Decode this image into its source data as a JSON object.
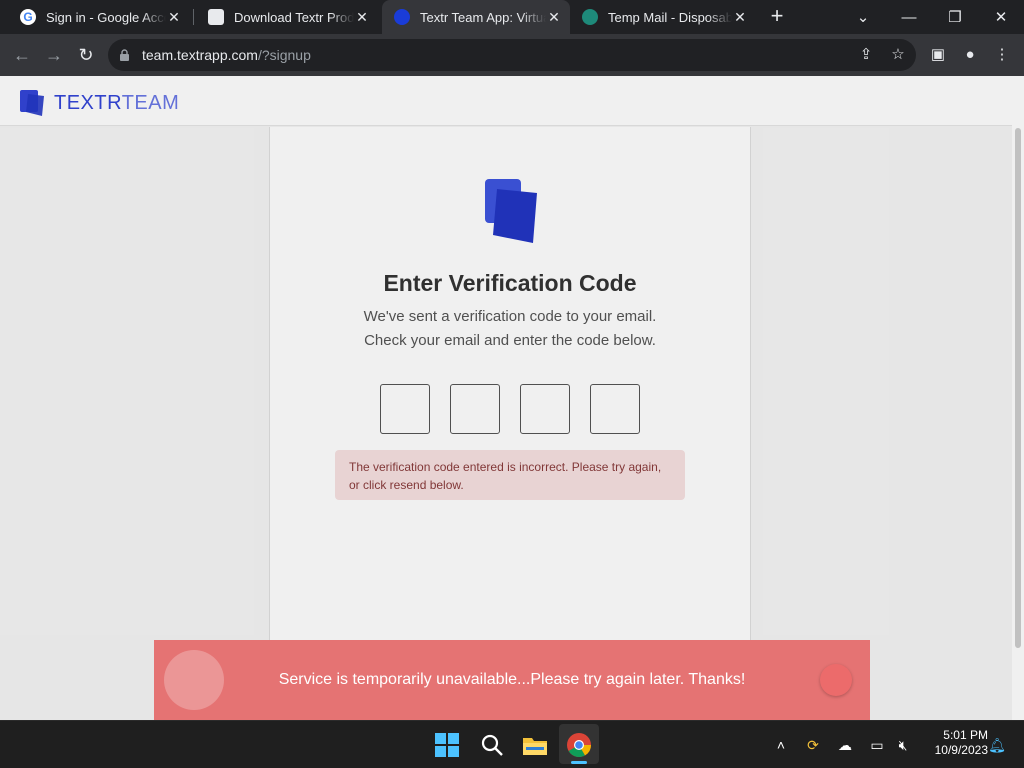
{
  "browser": {
    "tabs": [
      {
        "title": "Sign in - Google Accounts",
        "close": "✕"
      },
      {
        "title": "Download Textr Products",
        "close": "✕"
      },
      {
        "title": "Textr Team App: Virtual",
        "close": "✕"
      },
      {
        "title": "Temp Mail - Disposable",
        "close": "✕"
      }
    ],
    "new_tab": "+",
    "url_host": "team.textrapp.com",
    "url_path": "/?signup",
    "window_controls": {
      "chevron": "⌄",
      "minimize": "—",
      "restore": "❐",
      "close": "✕"
    },
    "nav": {
      "back": "←",
      "forward": "→",
      "reload": "↻"
    },
    "toolbar_icons": {
      "share": "⇪",
      "star": "☆",
      "sidepanel": "▣",
      "profile": "●",
      "menu": "⋮"
    }
  },
  "app": {
    "brand_primary": "TEXTR",
    "brand_secondary": "TEAM",
    "heading": "Enter Verification Code",
    "subtitle_line1": "We've sent a verification code to your email.",
    "subtitle_line2": "Check your email and enter the code below.",
    "code_values": [
      "",
      "",
      "",
      ""
    ],
    "error_text": "The verification code entered is incorrect. Please try again, or click resend below."
  },
  "toast": {
    "message": "Service is temporarily unavailable...Please try again later. Thanks!"
  },
  "taskbar": {
    "time": "5:01 PM",
    "date": "10/9/2023"
  },
  "colors": {
    "brand": "#3446d8",
    "toast": "#e57373",
    "error_bg": "#f7e1e1"
  }
}
